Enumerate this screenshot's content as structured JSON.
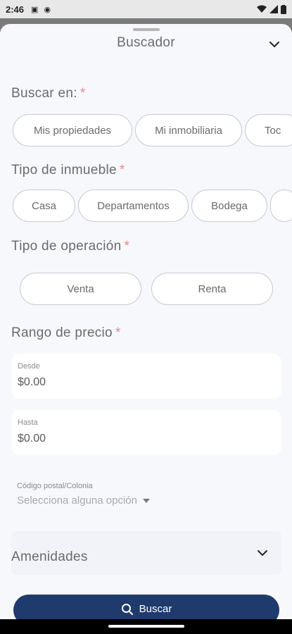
{
  "status_bar": {
    "time": "2:46"
  },
  "sheet": {
    "title": "Buscador"
  },
  "buscar_en": {
    "label": "Buscar en:",
    "required": "*",
    "options": [
      "Mis propiedades",
      "Mi inmobiliaria",
      "Toc"
    ]
  },
  "tipo_inmueble": {
    "label": "Tipo de inmueble",
    "required": "*",
    "options": [
      "Casa",
      "Departamentos",
      "Bodega",
      ""
    ]
  },
  "tipo_operacion": {
    "label": "Tipo de operación",
    "required": "*",
    "options": [
      "Venta",
      "Renta"
    ]
  },
  "rango_precio": {
    "label": "Rango de precio",
    "required": "*",
    "desde_label": "Desde",
    "desde_value": "$0.00",
    "hasta_label": "Hasta",
    "hasta_value": "$0.00"
  },
  "codigo_postal": {
    "label": "Código postal/Colonia",
    "placeholder": "Selecciona alguna opción"
  },
  "amenidades": {
    "label": "Amenidades"
  },
  "search_button": {
    "label": "Buscar"
  },
  "colors": {
    "primary": "#1f3a6c",
    "required": "#e58a8a",
    "chip_border": "#c7cbd3"
  }
}
